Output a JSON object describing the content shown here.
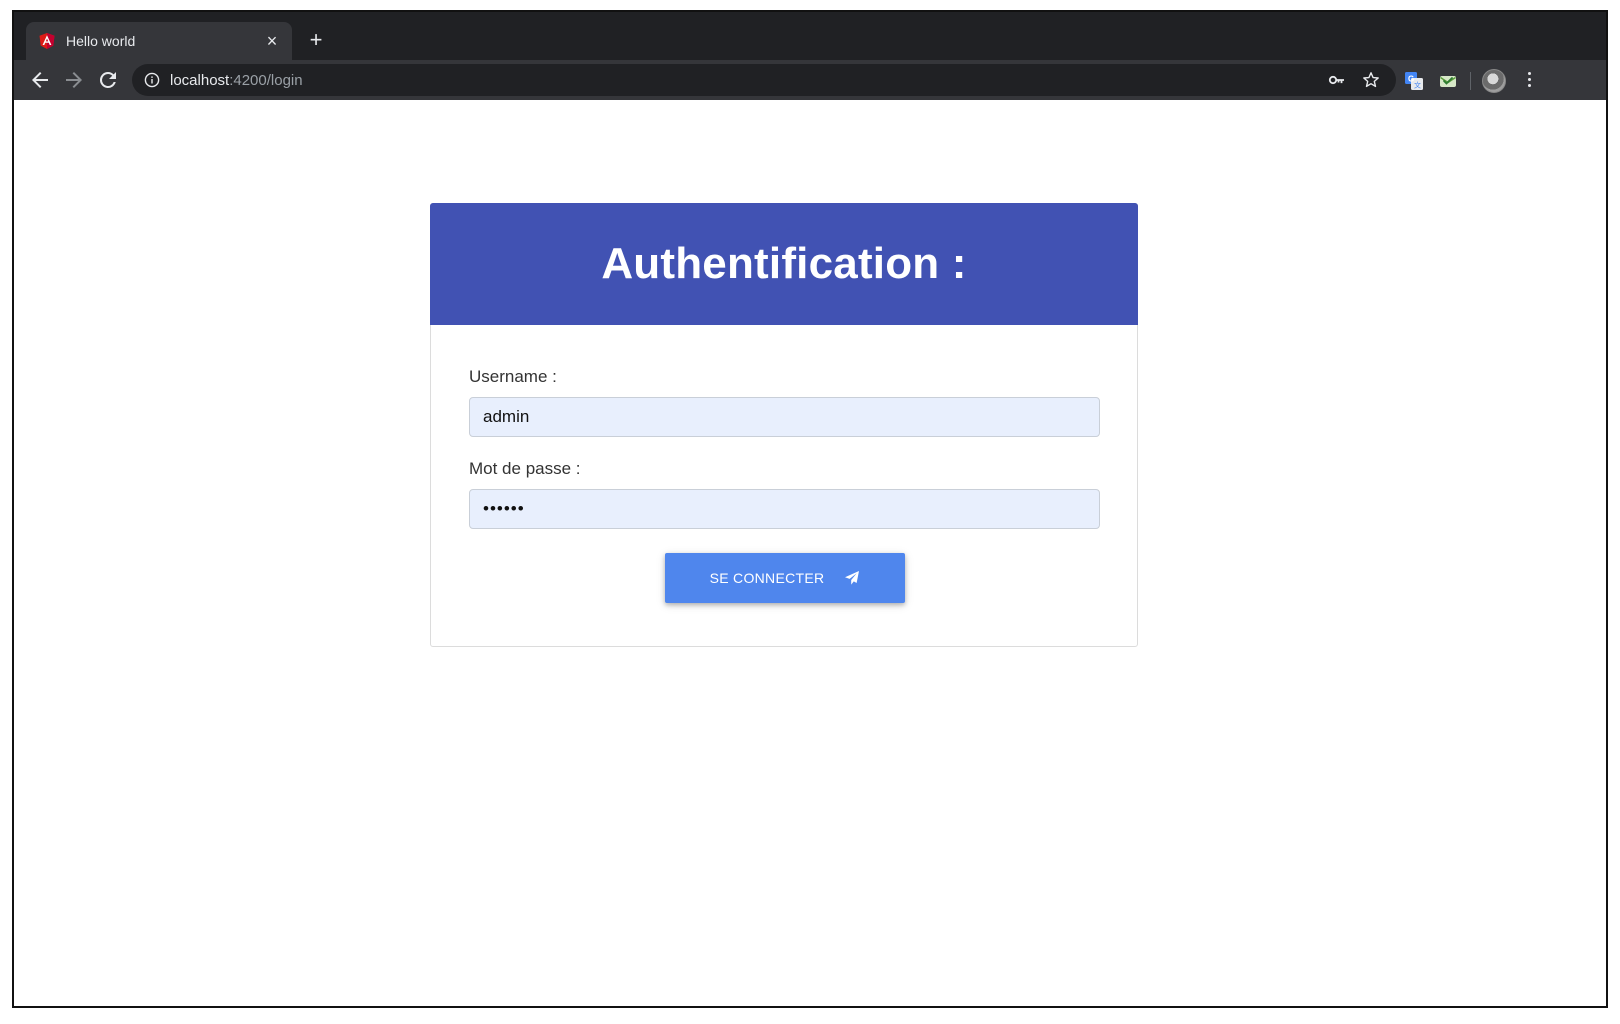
{
  "browser": {
    "tab": {
      "title": "Hello world",
      "favicon": "angular-icon",
      "close_label": "×"
    },
    "new_tab_label": "+",
    "address": {
      "host": "localhost",
      "rest": ":4200/login"
    },
    "icons": [
      "back-arrow-icon",
      "forward-arrow-icon",
      "reload-icon",
      "info-icon",
      "key-icon",
      "star-icon",
      "translate-extension-icon",
      "mail-extension-icon",
      "profile-avatar",
      "menu-dots-icon"
    ]
  },
  "login": {
    "title": "Authentification :",
    "username_label": "Username :",
    "username_value": "admin",
    "password_label": "Mot de passe :",
    "password_value": "••••••",
    "submit_label": "SE CONNECTER",
    "submit_icon": "paper-plane-icon"
  },
  "colors": {
    "header_bg": "#4152b3",
    "button_bg": "#4f86ed",
    "input_bg": "#e8effd",
    "chrome_dark": "#202124",
    "chrome_toolbar": "#35363a"
  }
}
